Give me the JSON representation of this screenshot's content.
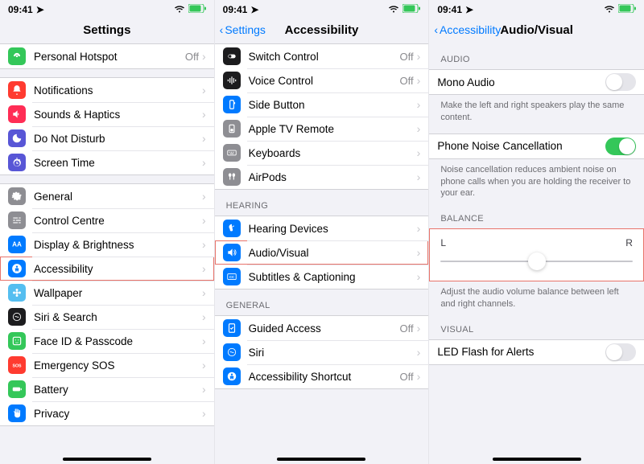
{
  "status": {
    "time": "09:41",
    "loc_icon": "location",
    "wifi": "wifi",
    "battery": "battery"
  },
  "screens": {
    "settings": {
      "title": "Settings",
      "groups": [
        {
          "rows": [
            {
              "icon": "personal-hotspot",
              "color": "#34c759",
              "label": "Personal Hotspot",
              "value": "Off"
            }
          ]
        },
        {
          "rows": [
            {
              "icon": "bell",
              "color": "#ff3b30",
              "label": "Notifications"
            },
            {
              "icon": "speaker",
              "color": "#ff2d55",
              "label": "Sounds & Haptics"
            },
            {
              "icon": "moon",
              "color": "#5856d6",
              "label": "Do Not Disturb"
            },
            {
              "icon": "timer",
              "color": "#5856d6",
              "label": "Screen Time"
            }
          ]
        },
        {
          "rows": [
            {
              "icon": "gear",
              "color": "#8e8e93",
              "label": "General"
            },
            {
              "icon": "switches",
              "color": "#8e8e93",
              "label": "Control Centre"
            },
            {
              "icon": "sun",
              "color": "#007aff",
              "label": "Display & Brightness"
            },
            {
              "icon": "person",
              "color": "#007aff",
              "label": "Accessibility",
              "highlight": true
            },
            {
              "icon": "flower",
              "color": "#55bef0",
              "label": "Wallpaper"
            },
            {
              "icon": "siri",
              "color": "#1c1c1e",
              "label": "Siri & Search"
            },
            {
              "icon": "faceid",
              "color": "#34c759",
              "label": "Face ID & Passcode"
            },
            {
              "icon": "sos",
              "color": "#ff3b30",
              "label": "Emergency SOS"
            },
            {
              "icon": "battery",
              "color": "#34c759",
              "label": "Battery"
            },
            {
              "icon": "hand",
              "color": "#007aff",
              "label": "Privacy"
            }
          ]
        }
      ]
    },
    "accessibility": {
      "back": "Settings",
      "title": "Accessibility",
      "groups": [
        {
          "rows": [
            {
              "icon": "switch",
              "color": "#1c1c1e",
              "label": "Switch Control",
              "value": "Off"
            },
            {
              "icon": "voice",
              "color": "#1c1c1e",
              "label": "Voice Control",
              "value": "Off"
            },
            {
              "icon": "side",
              "color": "#007aff",
              "label": "Side Button"
            },
            {
              "icon": "tv",
              "color": "#8e8e93",
              "label": "Apple TV Remote"
            },
            {
              "icon": "keyboard",
              "color": "#8e8e93",
              "label": "Keyboards"
            },
            {
              "icon": "airpods",
              "color": "#8e8e93",
              "label": "AirPods"
            }
          ]
        },
        {
          "header": "HEARING",
          "rows": [
            {
              "icon": "ear",
              "color": "#007aff",
              "label": "Hearing Devices"
            },
            {
              "icon": "audio",
              "color": "#007aff",
              "label": "Audio/Visual",
              "highlight": true
            },
            {
              "icon": "cc",
              "color": "#007aff",
              "label": "Subtitles & Captioning"
            }
          ]
        },
        {
          "header": "GENERAL",
          "rows": [
            {
              "icon": "guided",
              "color": "#007aff",
              "label": "Guided Access",
              "value": "Off"
            },
            {
              "icon": "siri2",
              "color": "#007aff",
              "label": "Siri"
            },
            {
              "icon": "shortcut",
              "color": "#007aff",
              "label": "Accessibility Shortcut",
              "value": "Off"
            }
          ]
        }
      ]
    },
    "audiovisual": {
      "back": "Accessibility",
      "title": "Audio/Visual",
      "audio_header": "AUDIO",
      "mono": {
        "label": "Mono Audio",
        "on": false
      },
      "mono_footer": "Make the left and right speakers play the same content.",
      "noise": {
        "label": "Phone Noise Cancellation",
        "on": true
      },
      "noise_footer": "Noise cancellation reduces ambient noise on phone calls when you are holding the receiver to your ear.",
      "balance_header": "BALANCE",
      "balance": {
        "left": "L",
        "right": "R"
      },
      "balance_footer": "Adjust the audio volume balance between left and right channels.",
      "visual_header": "VISUAL",
      "led": {
        "label": "LED Flash for Alerts",
        "on": false
      }
    }
  }
}
